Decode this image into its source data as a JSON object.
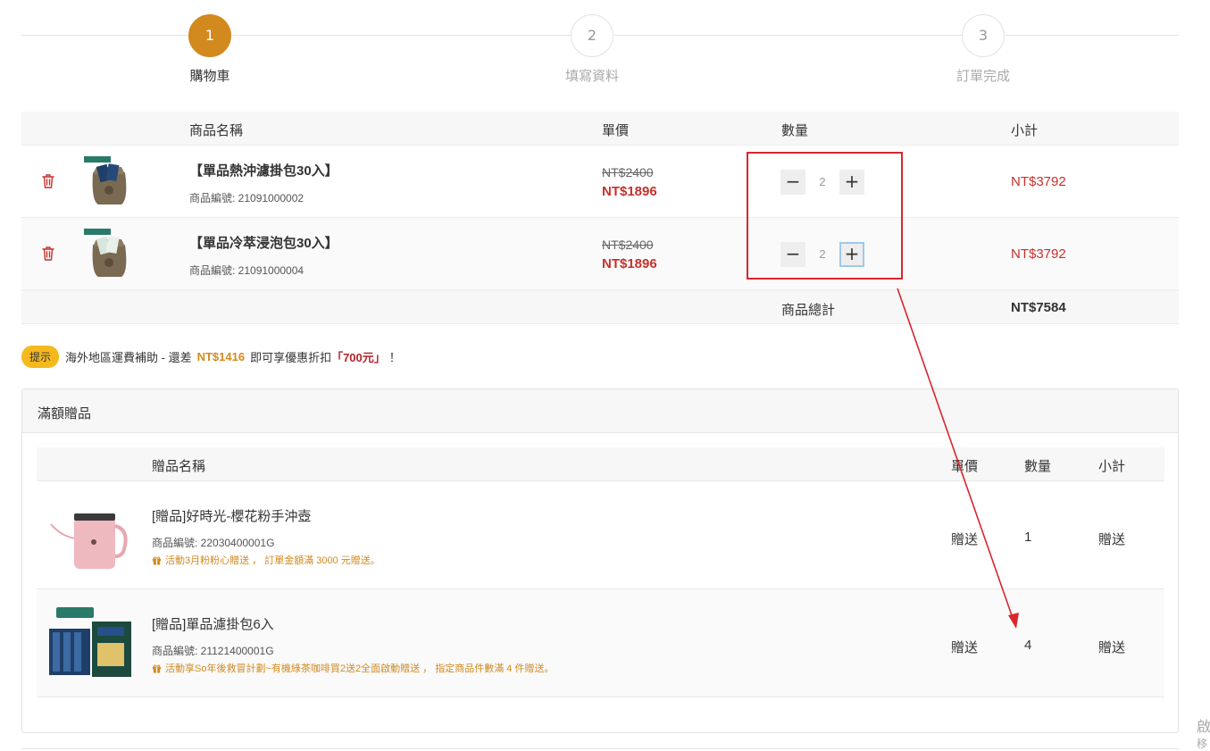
{
  "steps": [
    {
      "num": "1",
      "label": "購物車",
      "active": true
    },
    {
      "num": "2",
      "label": "填寫資料",
      "active": false
    },
    {
      "num": "3",
      "label": "訂單完成",
      "active": false
    }
  ],
  "cart": {
    "headers": {
      "name": "商品名稱",
      "price": "單價",
      "qty": "數量",
      "subtotal": "小計"
    },
    "items": [
      {
        "name": "【單品熱沖濾掛包30入】",
        "sku": "商品編號: 21091000002",
        "orig_price": "NT$2400",
        "sale_price": "NT$1896",
        "qty": "2",
        "subtotal": "NT$3792"
      },
      {
        "name": "【單品冷萃浸泡包30入】",
        "sku": "商品編號: 21091000004",
        "orig_price": "NT$2400",
        "sale_price": "NT$1896",
        "qty": "2",
        "subtotal": "NT$3792"
      }
    ],
    "total_label": "商品總計",
    "total_value": "NT$7584"
  },
  "tip": {
    "badge": "提示",
    "text_before": "海外地區運費補助 - 還差",
    "amount": "NT$1416",
    "text_mid": "即可享優惠折扣",
    "discount": "「700元」",
    "text_after": "！"
  },
  "gifts": {
    "title": "滿額贈品",
    "headers": {
      "name": "贈品名稱",
      "price": "單價",
      "qty": "數量",
      "subtotal": "小計"
    },
    "items": [
      {
        "name": "[贈品]好時光-櫻花粉手沖壺",
        "sku": "商品編號: 22030400001G",
        "promo": "活動3月粉粉心贈送 ， 訂單金額滿 3000 元贈送。",
        "price": "贈送",
        "qty": "1",
        "subtotal": "贈送"
      },
      {
        "name": "[贈品]單品濾掛包6入",
        "sku": "商品編號: 21121400001G",
        "promo": "活動享So年後救冒計劃~有機綠茶咖啡買2送2全面啟動贈送 ， 指定商品件數滿 4 件贈送。",
        "price": "贈送",
        "qty": "4",
        "subtotal": "贈送"
      }
    ]
  },
  "edge": {
    "line1": "啟",
    "line2": "移"
  },
  "colors": {
    "accent": "#d28a1e",
    "price_red": "#c8302c",
    "annotation": "#d9262c",
    "tip_badge": "#f5b91d"
  },
  "icons": {
    "delete": "trash-icon",
    "minus": "minus-icon",
    "plus": "plus-icon",
    "gift": "gift-icon"
  }
}
